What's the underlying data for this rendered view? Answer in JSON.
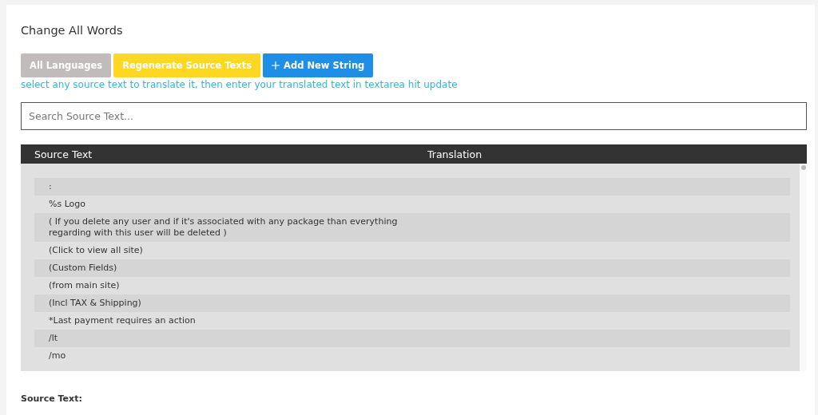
{
  "title": "Change All Words",
  "buttons": [
    {
      "label": "All Languages",
      "kind": "gray"
    },
    {
      "label": "Regenerate Source Texts",
      "kind": "yellow"
    },
    {
      "label": "Add New String",
      "kind": "blue"
    }
  ],
  "hint": "select any source text to translate it, then enter your translated text in textarea hit update",
  "search": {
    "placeholder": "Search Source Text..."
  },
  "table": {
    "columns": [
      "Source Text",
      "Translation"
    ],
    "rows": [
      ":",
      "%s Logo",
      "( If you delete any user and if it's associated with any package than everything regarding with this user will be deleted )",
      "(Click to view all site)",
      "(Custom Fields)",
      "(from main site)",
      "(Incl TAX & Shipping)",
      "*Last payment requires an action",
      "/lt",
      "/mo"
    ]
  },
  "source_label": "Source Text:"
}
